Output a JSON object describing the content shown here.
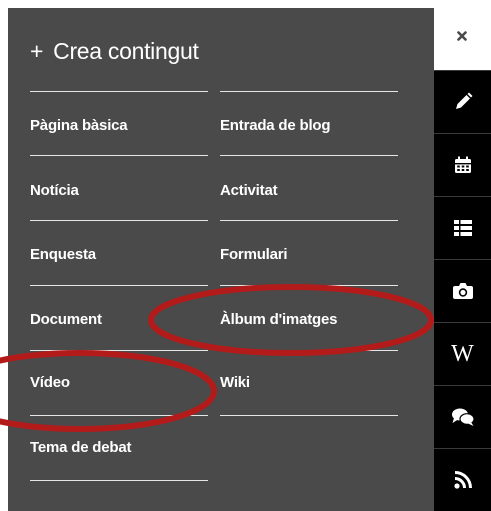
{
  "header": {
    "plus": "+",
    "title": "Crea contingut"
  },
  "menu": {
    "left": [
      "Pàgina bàsica",
      "Notícia",
      "Enquesta",
      "Document",
      "Vídeo",
      "Tema de debat"
    ],
    "right": [
      "Entrada de blog",
      "Activitat",
      "Formulari",
      "Àlbum d'imatges",
      "Wiki"
    ]
  },
  "rail": {
    "icons": [
      "pencil-icon",
      "calendar-icon",
      "list-icon",
      "camera-icon",
      "wikipedia-icon",
      "comments-icon",
      "rss-icon"
    ],
    "wiki_glyph": "W"
  },
  "close": {
    "icon": "close-icon"
  },
  "colors": {
    "panel": "#4a4a4a",
    "rail": "#000000",
    "text": "#ffffff",
    "annotation": "#b31b1b"
  }
}
